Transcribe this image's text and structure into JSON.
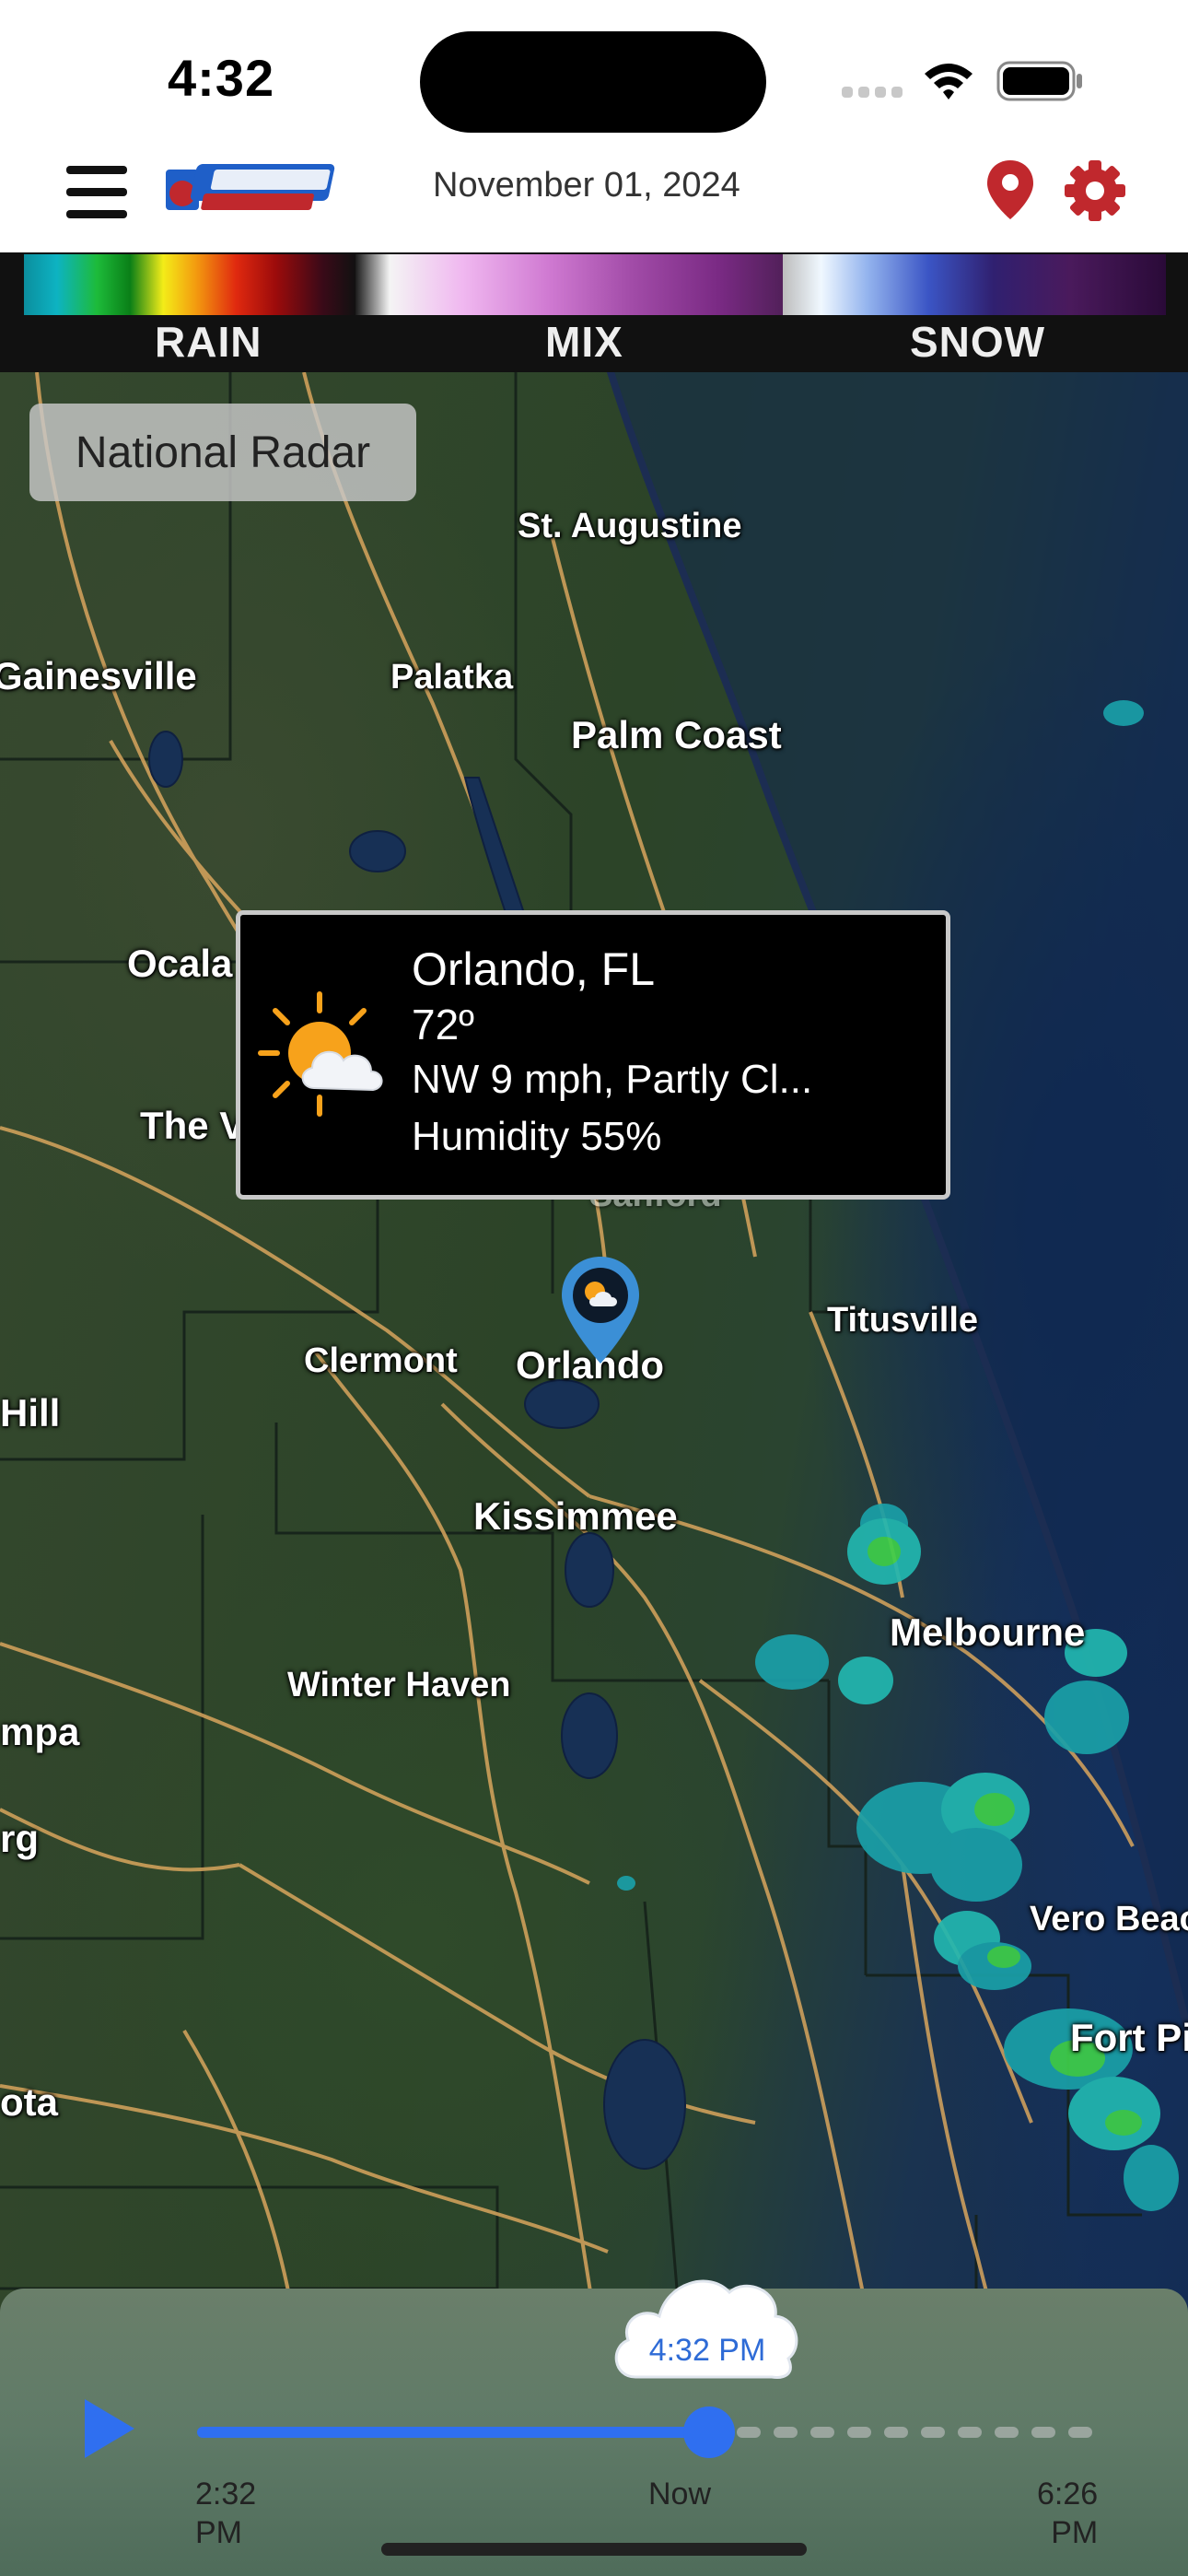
{
  "status_bar": {
    "time": "4:32"
  },
  "header": {
    "date": "November 01, 2024"
  },
  "legend": {
    "labels": [
      "RAIN",
      "MIX",
      "SNOW"
    ]
  },
  "map": {
    "layer_button": "National Radar",
    "cities": [
      "St. Augustine",
      "Gainesville",
      "Palatka",
      "Palm Coast",
      "Ocala",
      "The V",
      "Sanford",
      "Titusville",
      "Clermont",
      "Orlando",
      "Hill",
      "Kissimmee",
      "Melbourne",
      "Winter Haven",
      "mpa",
      "rg",
      "Vero Beac",
      "Fort Pie",
      "ota"
    ]
  },
  "popup": {
    "location": "Orlando, FL",
    "temperature": "72º",
    "conditions": "NW 9 mph,  Partly Cl...",
    "humidity": "Humidity 55%"
  },
  "timeline": {
    "current_time": "4:32 PM",
    "start_label": [
      "2:32",
      "PM"
    ],
    "now_label": "Now",
    "end_label": [
      "6:26",
      "PM"
    ],
    "progress_percent": 59
  },
  "colors": {
    "accent": "#2f6ff0",
    "brand_red": "#c0282d"
  },
  "icons": [
    "menu-icon",
    "location-pin-icon",
    "gear-icon",
    "play-icon",
    "partly-cloudy-icon",
    "wifi-icon",
    "battery-icon",
    "signal-icon"
  ]
}
